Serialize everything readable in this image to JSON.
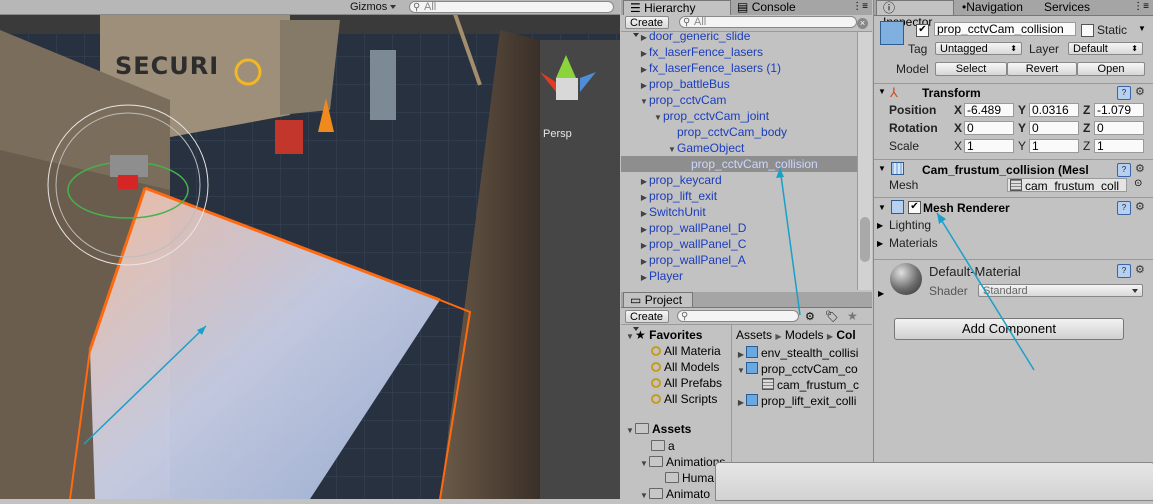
{
  "scene": {
    "gizmos_label": "Gizmos",
    "search_placeholder": "All",
    "persp_label": "Persp",
    "sign_text": "SECURI"
  },
  "hierarchy": {
    "tabs": [
      {
        "label": "Hierarchy",
        "icon": "list-icon"
      },
      {
        "label": "Console",
        "icon": "console-icon"
      }
    ],
    "create_label": "Create",
    "search_placeholder": "All",
    "items": [
      {
        "label": "door_generic_slide",
        "depth": 0,
        "expanded": false
      },
      {
        "label": "fx_laserFence_lasers",
        "depth": 0,
        "expanded": false
      },
      {
        "label": "fx_laserFence_lasers (1)",
        "depth": 0,
        "expanded": false
      },
      {
        "label": "prop_battleBus",
        "depth": 0,
        "expanded": false
      },
      {
        "label": "prop_cctvCam",
        "depth": 0,
        "expanded": true
      },
      {
        "label": "prop_cctvCam_joint",
        "depth": 1,
        "expanded": true
      },
      {
        "label": "prop_cctvCam_body",
        "depth": 2,
        "expanded": null
      },
      {
        "label": "GameObject",
        "depth": 2,
        "expanded": true
      },
      {
        "label": "prop_cctvCam_collision",
        "depth": 3,
        "expanded": null,
        "selected": true
      },
      {
        "label": "prop_keycard",
        "depth": 0,
        "expanded": false
      },
      {
        "label": "prop_lift_exit",
        "depth": 0,
        "expanded": false
      },
      {
        "label": "SwitchUnit",
        "depth": 0,
        "expanded": false
      },
      {
        "label": "prop_wallPanel_D",
        "depth": 0,
        "expanded": false
      },
      {
        "label": "prop_wallPanel_C",
        "depth": 0,
        "expanded": false
      },
      {
        "label": "prop_wallPanel_A",
        "depth": 0,
        "expanded": false
      },
      {
        "label": "Player",
        "depth": 0,
        "expanded": false
      }
    ]
  },
  "project": {
    "tab_label": "Project",
    "create_label": "Create",
    "favorites_label": "Favorites",
    "favorites": [
      "All Materia",
      "All Models",
      "All Prefabs",
      "All Scripts"
    ],
    "assets_label": "Assets",
    "assets_tree": [
      "a",
      "Animations",
      "Huma",
      "Animato"
    ],
    "breadcrumb": [
      "Assets",
      "Models",
      "Col"
    ],
    "files": [
      {
        "label": "env_stealth_collisi",
        "type": "model",
        "indent": 0
      },
      {
        "label": "prop_cctvCam_co",
        "type": "model",
        "indent": 0,
        "expanded": true
      },
      {
        "label": "cam_frustum_c",
        "type": "mesh",
        "indent": 1
      },
      {
        "label": "prop_lift_exit_colli",
        "type": "model",
        "indent": 0
      }
    ]
  },
  "inspector": {
    "tabs": [
      {
        "label": "Inspector",
        "icon": "info-icon"
      },
      {
        "label": "Navigation",
        "icon": "nav-icon"
      },
      {
        "label": "Services",
        "icon": ""
      }
    ],
    "object_name": "prop_cctvCam_collision",
    "static_label": "Static",
    "tag_label": "Tag",
    "tag_value": "Untagged",
    "layer_label": "Layer",
    "layer_value": "Default",
    "model_label": "Model",
    "model_buttons": [
      "Select",
      "Revert",
      "Open"
    ],
    "transform": {
      "title": "Transform",
      "rows": [
        {
          "label": "Position",
          "x": "-6.489",
          "y": "0.0316",
          "z": "-1.079"
        },
        {
          "label": "Rotation",
          "x": "0",
          "y": "0",
          "z": "0"
        },
        {
          "label": "Scale",
          "x": "1",
          "y": "1",
          "z": "1"
        }
      ]
    },
    "mesh_filter": {
      "title": "Cam_frustum_collision (Mesl",
      "mesh_label": "Mesh",
      "mesh_value": "cam_frustum_coll"
    },
    "mesh_renderer": {
      "title": "Mesh Renderer",
      "lighting_label": "Lighting",
      "materials_label": "Materials"
    },
    "material": {
      "name": "Default-Material",
      "shader_label": "Shader",
      "shader_value": "Standard"
    },
    "add_component_label": "Add Component"
  },
  "colors": {
    "panel_bg": "#c2c2c2",
    "hierarchy_text": "#1a3dbd",
    "selection": "#8e8e8e",
    "annotation_arrow": "#1aa0c8"
  }
}
